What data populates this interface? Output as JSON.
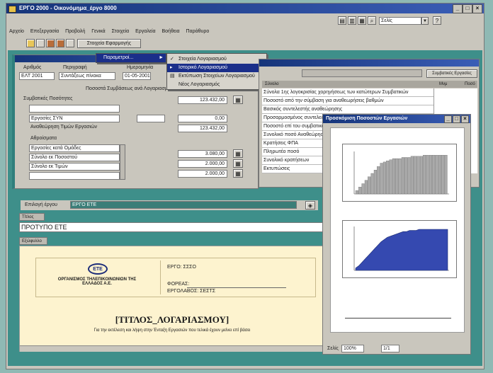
{
  "app": {
    "title": "ΕΡΓΟ 2000 - Οικονόμημα_έργο 8000",
    "menu": [
      "Αρχείο",
      "Επεξεργασία",
      "Προβολή",
      "Γενικά",
      "Στοιχεία",
      "Εργαλεία",
      "Βοήθεια",
      "Παράθυρο"
    ],
    "toolbar_label": "Στοιχεία Εφαρμογής",
    "search_combo": "Σελίς"
  },
  "context_menu": {
    "parent_label": "Παραμετροί...",
    "items": [
      {
        "label": "Στοιχεία Λογαριασμού",
        "selected": false
      },
      {
        "label": "Ιστορικό Λογαριασμού",
        "selected": true
      },
      {
        "label": "Εκτύπωση Στοιχείων Λογαριασμού",
        "selected": false
      },
      {
        "label": "Νέος Λογαριασμός",
        "selected": false
      }
    ]
  },
  "form": {
    "labels": {
      "col1": "Αριθμός",
      "col2": "Περιγραφή",
      "col3": "Ημερομηνία",
      "section": "Ποσοστά Συμβάσεως ανά Λογαριασμό",
      "sub1": "Συμβατικές Ποσότητες",
      "sub2": "Αναθεώρηση Τιμών Εργασιών",
      "sub3": "Αθροίσματα"
    },
    "row_values": {
      "num": "ΕΛΤ 2001",
      "desc": "Συντάξεως πίνακα",
      "date": "01-05-2001"
    },
    "list1": [
      "",
      "Εργασίες ΣΥΝ",
      ""
    ],
    "list2": [
      "Εργασίες κατά Ομάδες",
      "Σύνολο εκ Ποσοστού",
      "Σύνολο εκ Τιμών",
      ""
    ],
    "amounts1": [
      "123.432,00",
      "0,00",
      "123.432,00"
    ],
    "amounts2": [
      "3.080,00",
      "2.000,00",
      "2.000,00"
    ]
  },
  "right_grid": {
    "headers": [
      "Σύνολο",
      "Μνμ",
      "Ποσό"
    ],
    "rows": [
      "Σύνολα 1ης λογοκρισίας χορηγήσεως των κατώτερων Συμβατικών",
      "Ποσοστό από την σύμβαση για αναθεωρήσεις βαθμών",
      "Βασικός συντελεστής αναθεώρησης",
      "Προσαρμοσμένος συντελεστής",
      "Ποσοστό επί του συμβατικού",
      "Συνολικό ποσό Αναθεώρησης",
      "Κρατήσεις ΦΠΑ",
      "Πληρωτέο ποσό",
      "Συνολικό κρατήσεων",
      "Εκτυπώσεις"
    ],
    "button": "Συμβατικές Εργασίες"
  },
  "project_bar": {
    "label": "Επιλογή έργου",
    "value": "ΕΡΓΟ ΕΤΕ"
  },
  "title_strip": {
    "label": "Τίτλος",
    "value": "ΠΡΟΤΥΠΟ ΕΤΕ"
  },
  "preview": {
    "tab": "Εξώφυλλο",
    "org_logo": "ΕΤΕ",
    "org_name": "ΟΡΓΑΝΙΣΜΟΣ ΤΗΛΕΠΙΚΟΙΝΩΝΙΩΝ ΤΗΣ ΕΛΛΑΔΟΣ Α.Ε.",
    "field1": "ΕΡΓΟ: ΣΣΣΟ",
    "field2": "ΦΟΡΕΑΣ:",
    "field3": "ΕΡΓΟΛΑΒΟΣ: ΣΕΣΤΣ",
    "doc_title": "[ΤΙΤΛΟΣ_ΛΟΓΑΡΙΑΣΜΟΥ]",
    "doc_sub": "Για την εκτέλεση και λήψη στην Ένταξη Εργασιών που τελικά έχουν μείνει επί βάσει"
  },
  "chart_window": {
    "title": "Προσκόμιση Ποσοστών Εργασιών",
    "zoom_label": "Σελίς",
    "zoom_value": "100%",
    "page_value": "1/1"
  },
  "chart_data": [
    {
      "type": "bar",
      "title": "",
      "xlabel": "",
      "ylabel": "",
      "values": [
        3,
        6,
        9,
        12,
        15,
        18,
        21,
        24,
        27,
        28,
        29,
        30,
        31,
        31,
        31,
        32,
        32,
        32,
        33,
        33,
        33,
        33,
        34,
        34,
        34,
        34,
        34,
        34,
        34,
        34
      ]
    },
    {
      "type": "area",
      "title": "",
      "xlabel": "",
      "ylabel": "",
      "values": [
        2,
        4,
        7,
        10,
        13,
        16,
        19,
        22,
        25,
        27,
        29,
        30,
        31,
        32,
        33,
        34,
        34,
        35,
        35,
        35,
        36,
        36,
        36,
        36,
        36,
        36,
        36,
        36,
        36,
        36
      ]
    }
  ],
  "colors": {
    "desktop": "#8fb9b4",
    "titlebar": "#16357a",
    "accent_teal": "#2f7f7c",
    "selection": "#1b2f8a",
    "chart_area": "#3549b0",
    "chart_bar": "#aaaaaa",
    "paper": "#fdf3cf"
  }
}
